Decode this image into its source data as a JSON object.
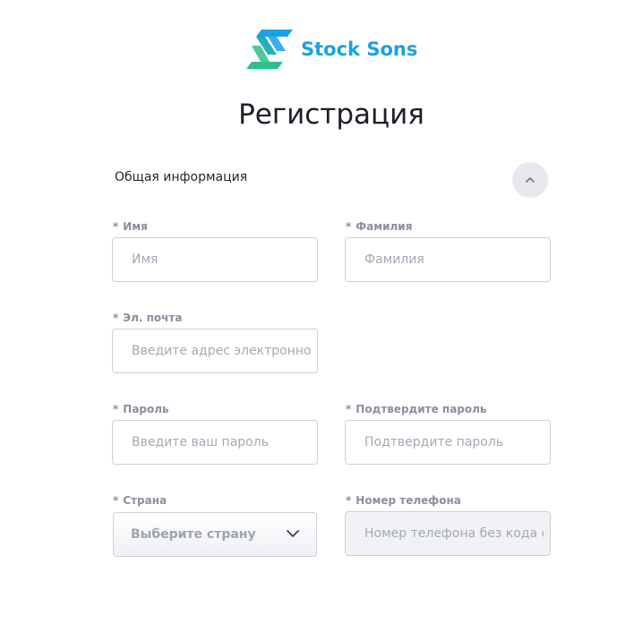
{
  "brand": {
    "name": "Stock Sons",
    "logo_icon": "stock-sons-logo-icon",
    "colors": {
      "blue": "#1aa0e6",
      "green": "#2bc08a"
    }
  },
  "page": {
    "title": "Регистрация"
  },
  "section": {
    "title": "Общая информация",
    "toggle_icon": "chevron-up-icon"
  },
  "fields": {
    "first_name": {
      "label": "Имя",
      "placeholder": "Имя",
      "required": "*"
    },
    "last_name": {
      "label": "Фамилия",
      "placeholder": "Фамилия",
      "required": "*"
    },
    "email": {
      "label": "Эл. почта",
      "placeholder": "Введите адрес электронной почты",
      "required": "*"
    },
    "password": {
      "label": "Пароль",
      "placeholder": "Введите ваш пароль",
      "required": "*"
    },
    "confirm_password": {
      "label": "Подтвердите пароль",
      "placeholder": "Подтвердите пароль",
      "required": "*"
    },
    "country": {
      "label": "Страна",
      "selected": "Выберите страну",
      "required": "*",
      "icon": "chevron-down-icon"
    },
    "phone": {
      "label": "Номер телефона",
      "placeholder": "Номер телефона без кода страны",
      "required": "*"
    }
  }
}
